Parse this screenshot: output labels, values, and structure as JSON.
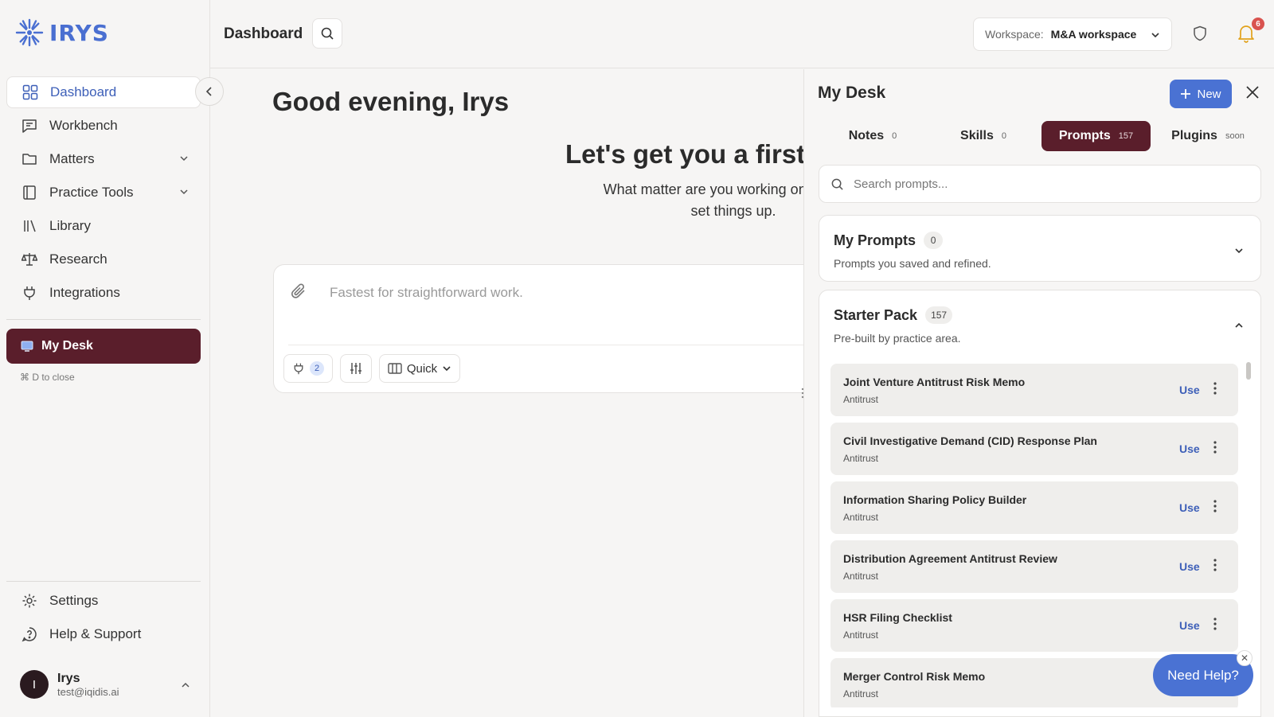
{
  "brand": {
    "name": "IRYS"
  },
  "sidebar": {
    "items": [
      {
        "label": "Dashboard",
        "icon": "grid-icon"
      },
      {
        "label": "Workbench",
        "icon": "chat-icon"
      },
      {
        "label": "Matters",
        "icon": "folder-icon"
      },
      {
        "label": "Practice Tools",
        "icon": "book-icon"
      },
      {
        "label": "Library",
        "icon": "library-icon"
      },
      {
        "label": "Research",
        "icon": "scale-icon"
      },
      {
        "label": "Integrations",
        "icon": "plug-icon"
      }
    ],
    "my_desk_label": "My Desk",
    "shortcut_hint": "⌘ D to close",
    "bottom_items": [
      {
        "label": "Settings",
        "icon": "gear-icon"
      },
      {
        "label": "Help & Support",
        "icon": "help-icon"
      }
    ],
    "user": {
      "initial": "I",
      "name": "Irys",
      "email": "test@iqidis.ai"
    }
  },
  "header": {
    "title": "Dashboard",
    "workspace_label": "Workspace:",
    "workspace_value": "M&A workspace",
    "notification_count": "6"
  },
  "main": {
    "greeting": "Good evening, Irys",
    "hero_title": "Let's get you a first r",
    "hero_sub_line1": "What matter are you working on? Tell me",
    "hero_sub_line2": "set things up.",
    "composer_placeholder": "Fastest for straightforward work.",
    "integrations_count": "2",
    "mode_label": "Quick"
  },
  "desk": {
    "title": "My Desk",
    "new_label": "New",
    "tabs": [
      {
        "label": "Notes",
        "count": "0"
      },
      {
        "label": "Skills",
        "count": "0"
      },
      {
        "label": "Prompts",
        "count": "157"
      },
      {
        "label": "Plugins",
        "count": "soon"
      }
    ],
    "search_placeholder": "Search prompts...",
    "my_prompts": {
      "title": "My Prompts",
      "count": "0",
      "subtitle": "Prompts you saved and refined."
    },
    "starter_pack": {
      "title": "Starter Pack",
      "count": "157",
      "subtitle": "Pre-built by practice area."
    },
    "use_label": "Use",
    "prompts": [
      {
        "title": "Joint Venture Antitrust Risk Memo",
        "category": "Antitrust"
      },
      {
        "title": "Civil Investigative Demand (CID) Response Plan",
        "category": "Antitrust"
      },
      {
        "title": "Information Sharing Policy Builder",
        "category": "Antitrust"
      },
      {
        "title": "Distribution Agreement Antitrust Review",
        "category": "Antitrust"
      },
      {
        "title": "HSR Filing Checklist",
        "category": "Antitrust"
      },
      {
        "title": "Merger Control Risk Memo",
        "category": "Antitrust"
      }
    ]
  },
  "help": {
    "label": "Need Help?"
  },
  "colors": {
    "accent": "#4a72d3",
    "brand_dark": "#5a1e2b",
    "background": "#f6f5f4"
  }
}
